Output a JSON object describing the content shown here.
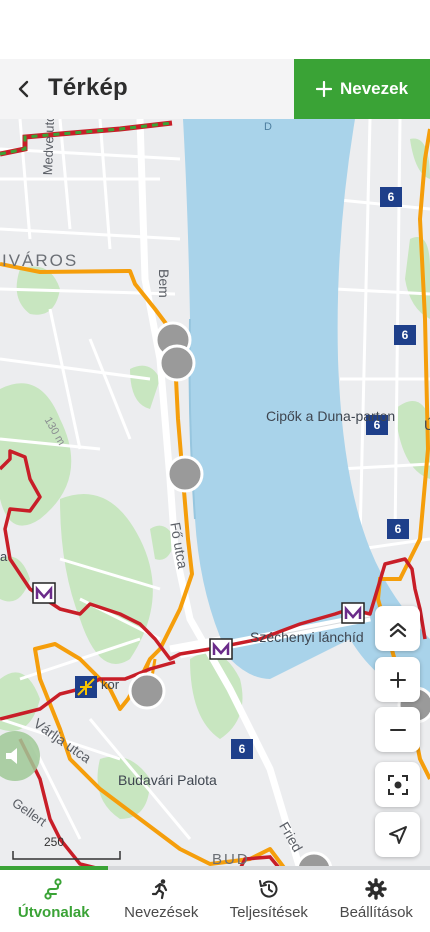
{
  "header": {
    "title": "Térkép",
    "action_label": "Nevezek"
  },
  "map": {
    "labels": {
      "district": "IVÁROS",
      "medve": "Medve utca",
      "bem": "Bem",
      "fo": "Fő utca",
      "danube": "D",
      "shoes": "Cipők a Duna-parton",
      "shoes_partial": "Ú",
      "bridge": "Széchenyi lánchíd",
      "elev": "130 m",
      "varalja": "Várlja utca",
      "palace": "Budavári Palota",
      "gellert": "Gellert",
      "bud": "BUD",
      "fried": "Fried",
      "kor": "kor",
      "a": "a",
      "scale": "250"
    },
    "route_badges": [
      "6",
      "6",
      "6",
      "6",
      "6"
    ]
  },
  "controls": {
    "collapse": "chevrons-up-icon",
    "zoom_in": "plus-icon",
    "zoom_out": "minus-icon",
    "locate": "focus-icon",
    "navigate": "navigation-arrow-icon"
  },
  "colors": {
    "accent": "#3aa336",
    "route_orange": "#f59e0b",
    "route_red": "#c81e28",
    "water": "#a9d3ea"
  },
  "progress": 0.25,
  "nav": [
    {
      "label": "Útvonalak",
      "icon": "route-icon",
      "active": true
    },
    {
      "label": "Nevezések",
      "icon": "runner-icon",
      "active": false
    },
    {
      "label": "Teljesítések",
      "icon": "history-icon",
      "active": false
    },
    {
      "label": "Beállítások",
      "icon": "gear-icon",
      "active": false
    }
  ]
}
